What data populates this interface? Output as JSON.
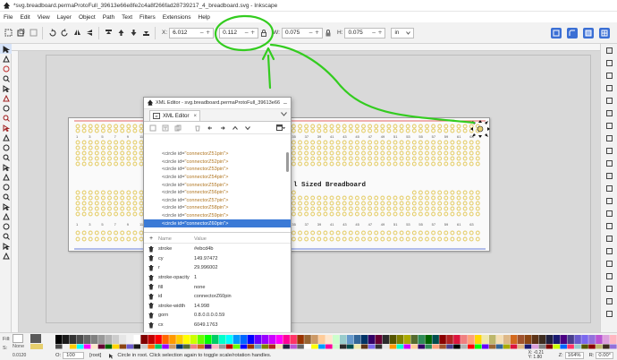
{
  "window": {
    "title": "*svg.breadboard.permaProtoFull_39613e66e8fe2c4a8f266fad28739217_4_breadboard.svg - Inkscape"
  },
  "menu": [
    "File",
    "Edit",
    "View",
    "Layer",
    "Object",
    "Path",
    "Text",
    "Filters",
    "Extensions",
    "Help"
  ],
  "toolbar": {
    "x_label": "X:",
    "x_value": "6.012",
    "y_label": "Y:",
    "y_value": "0.112",
    "w_label": "W:",
    "w_value": "0.075",
    "h_label": "H:",
    "h_value": "0.075",
    "unit": "in",
    "minus": "−",
    "plus": "+"
  },
  "canvas": {
    "breadboard_title": "l Sized Breadboard",
    "highlight_color": "#33cc1f",
    "hole_color": "#e6cf6e"
  },
  "xml_editor": {
    "title": "XML Editor - svg.breadboard.permaProtoFull_39613e66...",
    "tab_label": "XML Editor",
    "tab_close": "×",
    "nodes": [
      {
        "tag": "<circle id=",
        "id": "\"connectorZ50pin\">"
      },
      {
        "tag": "<circle id=",
        "id": "\"connectorZ51pin\">"
      },
      {
        "tag": "<circle id=",
        "id": "\"connectorZ52pin\">"
      },
      {
        "tag": "<circle id=",
        "id": "\"connectorZ53pin\">"
      },
      {
        "tag": "<circle id=",
        "id": "\"connectorZ54pin\">"
      },
      {
        "tag": "<circle id=",
        "id": "\"connectorZ55pin\">"
      },
      {
        "tag": "<circle id=",
        "id": "\"connectorZ56pin\">"
      },
      {
        "tag": "<circle id=",
        "id": "\"connectorZ57pin\">"
      },
      {
        "tag": "<circle id=",
        "id": "\"connectorZ58pin\">"
      },
      {
        "tag": "<circle id=",
        "id": "\"connectorZ59pin\">"
      },
      {
        "tag": "<circle id=",
        "id": "\"connectorZ60pin\">"
      }
    ],
    "selected_index": 10,
    "attr_header": {
      "plus": "+",
      "name": "Name",
      "value": "Value"
    },
    "attributes": [
      {
        "name": "stroke",
        "value": "#ebcd4b"
      },
      {
        "name": "cy",
        "value": "149.97472"
      },
      {
        "name": "r",
        "value": "29.996002"
      },
      {
        "name": "stroke-opacity",
        "value": "1"
      },
      {
        "name": "fill",
        "value": "none"
      },
      {
        "name": "id",
        "value": "connectorZ60pin"
      },
      {
        "name": "stroke-width",
        "value": "14.998"
      },
      {
        "name": "gorn",
        "value": "0.8.0.0.0.0.59"
      },
      {
        "name": "cx",
        "value": "6049.1763"
      }
    ]
  },
  "status": {
    "fill_label": "Fill:",
    "fill_value": "None",
    "stroke_label": "S:",
    "stroke_value": "0.0120",
    "opacity_label": "O:",
    "opacity_value": "100",
    "layer": "[root]",
    "message": "Circle in root. Click selection again to toggle scale/rotation handles.",
    "x_readout": "X: -0.21",
    "y_readout": "Y: 1.80",
    "zoom_label": "Z:",
    "zoom": "164%",
    "rotation_label": "R:",
    "rotation": "0.00°"
  },
  "palette": [
    "#000000",
    "#1a1a1a",
    "#333333",
    "#4d4d4d",
    "#666666",
    "#808080",
    "#999999",
    "#b3b3b3",
    "#cccccc",
    "#e6e6e6",
    "#f2f2f2",
    "#ffffff",
    "#800000",
    "#c00000",
    "#ff0000",
    "#ff6600",
    "#ff9900",
    "#ffcc00",
    "#ffff00",
    "#ccff00",
    "#66ff00",
    "#00ff00",
    "#00cc66",
    "#00ffcc",
    "#00ffff",
    "#0099ff",
    "#0066ff",
    "#0000ff",
    "#6600ff",
    "#9900ff",
    "#cc00ff",
    "#ff00ff",
    "#ff0099",
    "#ff3366",
    "#993300",
    "#996633",
    "#cc9966",
    "#ffcc99",
    "#ffe6cc",
    "#ccffcc",
    "#99cccc",
    "#6699cc",
    "#336699",
    "#003366",
    "#330066",
    "#660033",
    "#2b2b2b",
    "#555500",
    "#808000",
    "#aaaa00",
    "#556b2f",
    "#2e8b57",
    "#006400",
    "#004d4d",
    "#8b0000",
    "#b22222",
    "#dc143c",
    "#f08080",
    "#ffa07a",
    "#ffd700",
    "#eee8aa",
    "#bdb76b",
    "#f5deb3",
    "#deb887",
    "#d2691e",
    "#a0522d",
    "#8b4513",
    "#5c3317",
    "#3d2b1f",
    "#1f1f3d",
    "#191970",
    "#4b0082",
    "#483d8b",
    "#6a5acd",
    "#7b68ee",
    "#9370db",
    "#ba55d3",
    "#dda0dd",
    "#ffb6c1"
  ]
}
